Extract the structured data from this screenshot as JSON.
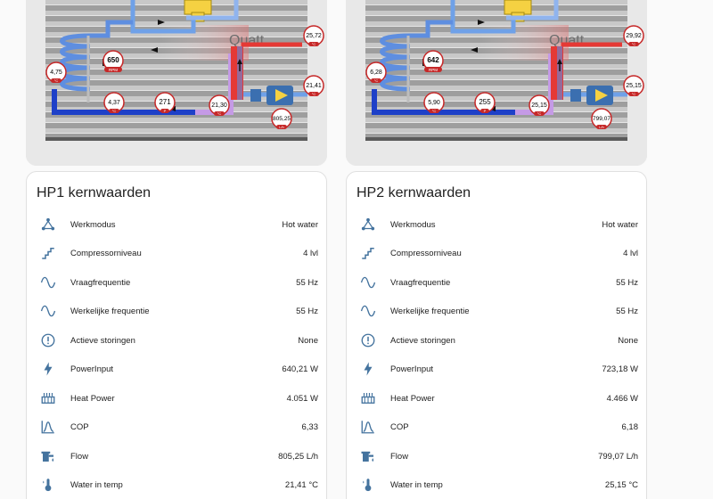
{
  "colors": {
    "ink": "#212121",
    "accent_icon": "#44739e",
    "hot": "#e53935",
    "cold": "#1e40c8",
    "card_bg": "#ffffff"
  },
  "heatpumps": [
    {
      "diagram": {
        "brand": "Quatt",
        "rpm": "650",
        "rpm_unit": "RPM",
        "temp_top_right": "25,72",
        "temp_left": "4,75",
        "temp_bottom_left": "4,37",
        "pressure": "271",
        "temp_mid": "21,30",
        "temp_pump": "21,41",
        "flow": "805,25",
        "flow_unit": "L/h",
        "unit_c": "°C",
        "unit_p": "P"
      },
      "card": {
        "title": "HP1 kernwaarden",
        "rows": [
          {
            "label": "Werkmodus",
            "value": "Hot water",
            "icon": "hub-icon"
          },
          {
            "label": "Compressorniveau",
            "value": "4 lvl",
            "icon": "stairs-icon"
          },
          {
            "label": "Vraagfrequentie",
            "value": "55 Hz",
            "icon": "sine-wave-icon"
          },
          {
            "label": "Werkelijke frequentie",
            "value": "55 Hz",
            "icon": "sine-wave-icon"
          },
          {
            "label": "Actieve storingen",
            "value": "None",
            "icon": "alert-circle-icon"
          },
          {
            "label": "PowerInput",
            "value": "640,21 W",
            "icon": "flash-icon"
          },
          {
            "label": "Heat Power",
            "value": "4.051 W",
            "icon": "radiator-icon"
          },
          {
            "label": "COP",
            "value": "6,33",
            "icon": "chart-bell-icon"
          },
          {
            "label": "Flow",
            "value": "805,25 L/h",
            "icon": "water-pump-icon"
          },
          {
            "label": "Water in temp",
            "value": "21,41 °C",
            "icon": "thermometer-water-icon"
          }
        ]
      }
    },
    {
      "diagram": {
        "brand": "Quatt",
        "rpm": "642",
        "rpm_unit": "RPM",
        "temp_top_right": "29,92",
        "temp_left": "6,28",
        "temp_bottom_left": "5,90",
        "pressure": "255",
        "temp_mid": "25,15",
        "temp_pump": "25,15",
        "flow": "799,07",
        "flow_unit": "L/h",
        "unit_c": "°C",
        "unit_p": "P"
      },
      "card": {
        "title": "HP2 kernwaarden",
        "rows": [
          {
            "label": "Werkmodus",
            "value": "Hot water",
            "icon": "hub-icon"
          },
          {
            "label": "Compressorniveau",
            "value": "4 lvl",
            "icon": "stairs-icon"
          },
          {
            "label": "Vraagfrequentie",
            "value": "55 Hz",
            "icon": "sine-wave-icon"
          },
          {
            "label": "Werkelijke frequentie",
            "value": "55 Hz",
            "icon": "sine-wave-icon"
          },
          {
            "label": "Actieve storingen",
            "value": "None",
            "icon": "alert-circle-icon"
          },
          {
            "label": "PowerInput",
            "value": "723,18 W",
            "icon": "flash-icon"
          },
          {
            "label": "Heat Power",
            "value": "4.466 W",
            "icon": "radiator-icon"
          },
          {
            "label": "COP",
            "value": "6,18",
            "icon": "chart-bell-icon"
          },
          {
            "label": "Flow",
            "value": "799,07 L/h",
            "icon": "water-pump-icon"
          },
          {
            "label": "Water in temp",
            "value": "25,15 °C",
            "icon": "thermometer-water-icon"
          }
        ]
      }
    }
  ]
}
